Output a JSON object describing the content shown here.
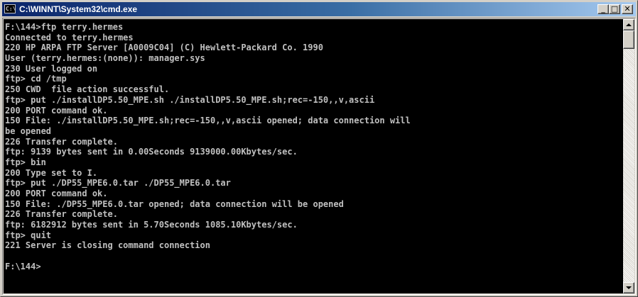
{
  "window": {
    "title": "C:\\WINNT\\System32\\cmd.exe",
    "icon_text": "C:\\",
    "minimize_glyph": "_",
    "maximize_glyph": "□",
    "close_glyph": "✕"
  },
  "console": {
    "lines": [
      "F:\\144>ftp terry.hermes",
      "Connected to terry.hermes",
      "220 HP ARPA FTP Server [A0009C04] (C) Hewlett-Packard Co. 1990",
      "User (terry.hermes:(none)): manager.sys",
      "230 User logged on",
      "ftp> cd /tmp",
      "250 CWD  file action successful.",
      "ftp> put ./installDP5.50_MPE.sh ./installDP5.50_MPE.sh;rec=-150,,v,ascii",
      "200 PORT command ok.",
      "150 File: ./installDP5.50_MPE.sh;rec=-150,,v,ascii opened; data connection will",
      "be opened",
      "226 Transfer complete.",
      "ftp: 9139 bytes sent in 0.00Seconds 9139000.00Kbytes/sec.",
      "ftp> bin",
      "200 Type set to I.",
      "ftp> put ./DP55_MPE6.0.tar ./DP55_MPE6.0.tar",
      "200 PORT command ok.",
      "150 File: ./DP55_MPE6.0.tar opened; data connection will be opened",
      "226 Transfer complete.",
      "ftp: 6182912 bytes sent in 5.70Seconds 1085.10Kbytes/sec.",
      "ftp> quit",
      "221 Server is closing command connection",
      "",
      "F:\\144>"
    ]
  },
  "colors": {
    "title_gradient_start": "#0a246a",
    "title_gradient_end": "#a6caf0",
    "console_bg": "#000000",
    "console_fg": "#c0c0c0"
  }
}
